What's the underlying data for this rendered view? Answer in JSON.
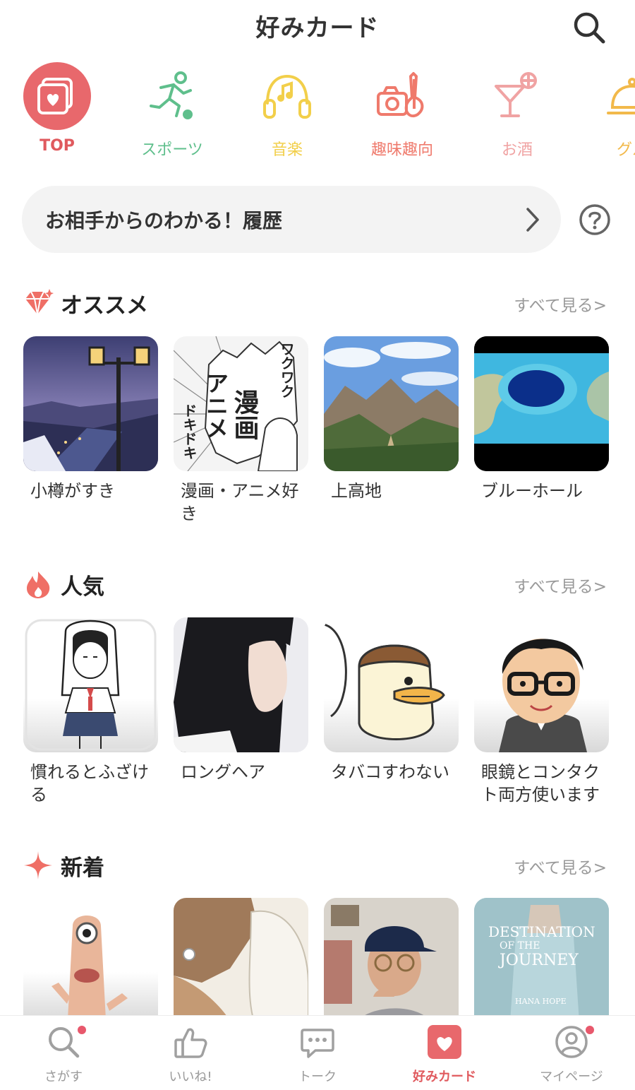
{
  "header": {
    "title": "好みカード"
  },
  "categories": [
    {
      "label": "TOP",
      "color": "#e05a5e",
      "icon": "heart-card-icon"
    },
    {
      "label": "スポーツ",
      "color": "#5fbf8c",
      "icon": "runner-icon"
    },
    {
      "label": "音楽",
      "color": "#f2cf4a",
      "icon": "headphones-icon"
    },
    {
      "label": "趣味趣向",
      "color": "#ef7a6c",
      "icon": "camera-guitar-icon"
    },
    {
      "label": "お酒",
      "color": "#f0a3a3",
      "icon": "cocktail-icon"
    },
    {
      "label": "グル",
      "color": "#f2b94a",
      "icon": "cloche-icon"
    }
  ],
  "history": {
    "label": "お相手からのわかる！履歴"
  },
  "sections": {
    "recommend": {
      "title": "オススメ",
      "more": "すべて見る",
      "cards": [
        {
          "caption": "小樽がすき"
        },
        {
          "caption": "漫画・アニメ好き"
        },
        {
          "caption": "上高地"
        },
        {
          "caption": "ブルーホール"
        }
      ]
    },
    "popular": {
      "title": "人気",
      "more": "すべて見る",
      "cards": [
        {
          "caption": "慣れるとふざける"
        },
        {
          "caption": "ロングヘア"
        },
        {
          "caption": "タバコすわない"
        },
        {
          "caption": "眼鏡とコンタクト両方使います"
        }
      ]
    },
    "new": {
      "title": "新着",
      "more": "すべて見る",
      "cards": [
        {
          "caption": ""
        },
        {
          "caption": ""
        },
        {
          "caption": ""
        },
        {
          "caption": ""
        }
      ]
    }
  },
  "manga_art_text": {
    "title": "漫画",
    "sub": "アニメ",
    "side1": "ワクワク",
    "side2": "ドキドキ"
  },
  "album_art_text": {
    "line1": "DESTINATION",
    "line2": "OF THE",
    "line3": "JOURNEY",
    "artist": "HANA HOPE"
  },
  "tabs": [
    {
      "label": "さがす",
      "icon": "search-icon",
      "badge": true
    },
    {
      "label": "いいね!",
      "icon": "thumbs-up-icon",
      "badge": false
    },
    {
      "label": "トーク",
      "icon": "chat-bubble-icon",
      "badge": false
    },
    {
      "label": "好みカード",
      "icon": "heart-card-icon",
      "badge": false,
      "active": true
    },
    {
      "label": "マイページ",
      "icon": "profile-icon",
      "badge": true
    }
  ],
  "colors": {
    "accent": "#e05a5e",
    "muted": "#9a9a9a",
    "pill": "#f3f3f3"
  }
}
